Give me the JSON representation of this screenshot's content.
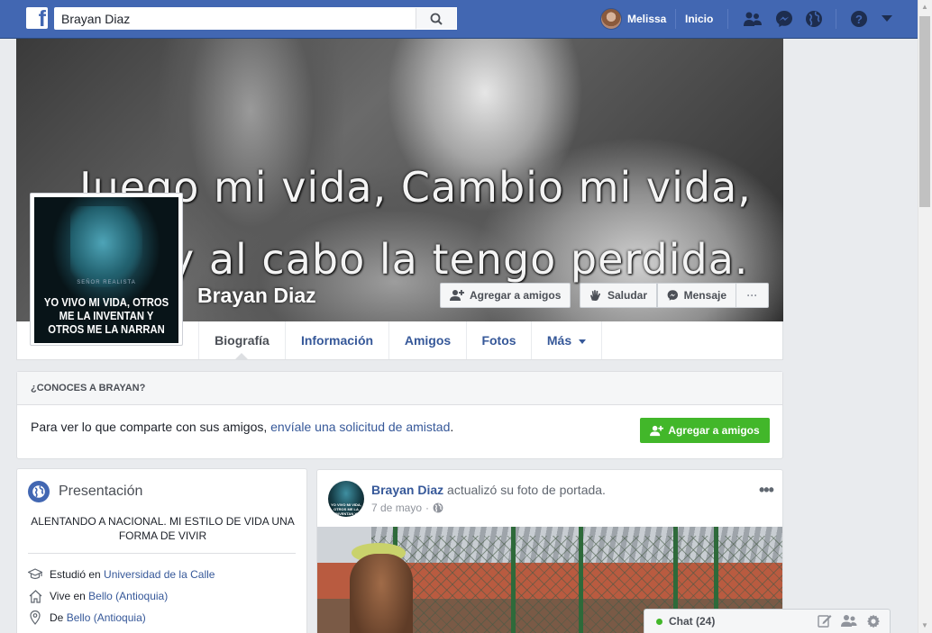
{
  "topbar": {
    "search_value": "Brayan Diaz",
    "user_name": "Melissa",
    "home_label": "Inicio",
    "logo_letter": "f"
  },
  "cover": {
    "quote_line1": "Juego mi vida, Cambio mi vida,",
    "quote_line2": "y al cabo la tengo perdida."
  },
  "profile": {
    "name": "Brayan Diaz",
    "picture_small_text": "SEÑOR REALISTA",
    "picture_text": "YO VIVO MI VIDA, OTROS ME LA INVENTAN Y OTROS ME LA NARRAN"
  },
  "actions": {
    "add_friend": "Agregar a amigos",
    "wave": "Saludar",
    "message": "Mensaje",
    "more": "···"
  },
  "tabs": [
    {
      "label": "Biografía"
    },
    {
      "label": "Información"
    },
    {
      "label": "Amigos"
    },
    {
      "label": "Fotos"
    },
    {
      "label": "Más"
    }
  ],
  "know_box": {
    "title": "¿CONOCES A BRAYAN?",
    "text": "Para ver lo que comparte con sus amigos, ",
    "link": "envíale una solicitud de amistad",
    "text_end": ".",
    "button": "Agregar a amigos"
  },
  "intro": {
    "title": "Presentación",
    "bio": "ALENTANDO A NACIONAL. MI ESTILO DE VIDA UNA FORMA DE VIVIR",
    "rows": [
      {
        "prefix": "Estudió en ",
        "link": "Universidad de la Calle"
      },
      {
        "prefix": "Vive en ",
        "link": "Bello (Antioquia)"
      },
      {
        "prefix": "De ",
        "link": "Bello (Antioquia)"
      }
    ]
  },
  "post": {
    "author": "Brayan Diaz",
    "action": " actualizó su foto de portada.",
    "date": "7 de mayo",
    "dot": "·",
    "avatar_text": "YO VIVO MI VIDA, OTROS ME LA INVENTAN Y OTROS ME LA NARRAN"
  },
  "chat": {
    "label": "Chat (24)"
  },
  "colors": {
    "brand": "#4267b2",
    "link": "#365899",
    "green": "#42b72a"
  },
  "icons": [
    "facebook-logo-icon",
    "search-icon",
    "friend-requests-icon",
    "messenger-icon",
    "notifications-globe-icon",
    "help-icon",
    "caret-down-icon",
    "add-friend-icon",
    "wave-icon",
    "globe-icon",
    "graduation-cap-icon",
    "home-icon",
    "location-pin-icon",
    "public-globe-icon",
    "compose-icon",
    "group-icon",
    "gear-icon"
  ]
}
